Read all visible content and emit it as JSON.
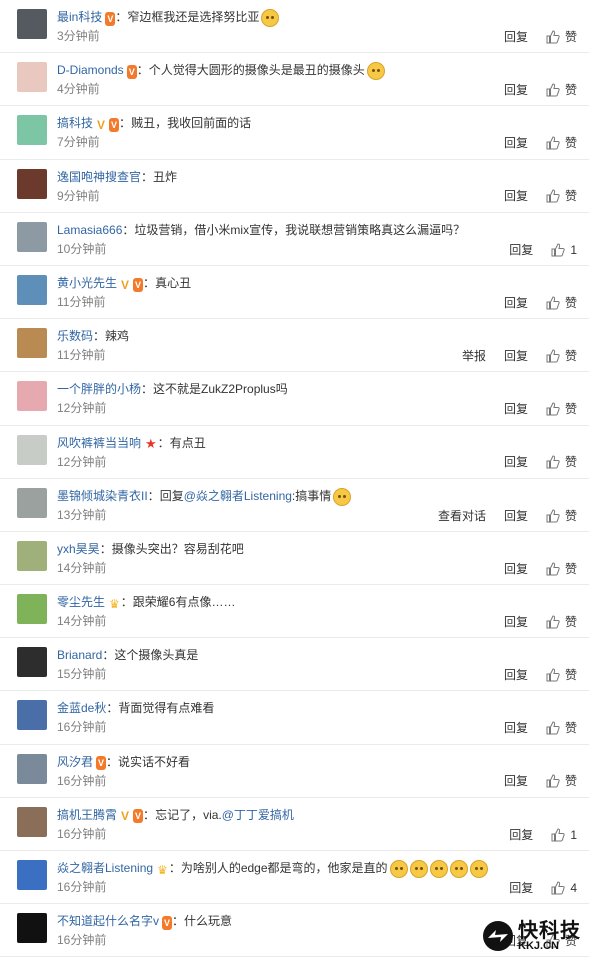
{
  "actions": {
    "reply": "回复",
    "report": "举报",
    "view_conversation": "查看对话",
    "like": "赞"
  },
  "colors": {
    "username": "#3266a3",
    "time": "#808080",
    "text": "#333333"
  },
  "watermark": {
    "cn": "快科技",
    "en": "KKJ.CN"
  },
  "comments": [
    {
      "avatar": {
        "color": "#555a60",
        "icon": "bird-avatar"
      },
      "user": "最in科技",
      "badges": [
        "vip"
      ],
      "text": "窄边框我还是选择努比亚",
      "emojis": 1,
      "time": "3分钟前",
      "report": false,
      "conversation": false,
      "likes": ""
    },
    {
      "avatar": {
        "color": "#e9c8c0",
        "icon": "girl-avatar"
      },
      "user": "D-Diamonds",
      "badges": [
        "vip"
      ],
      "text": "个人觉得大圆形的摄像头是最丑的摄像头",
      "emojis": 1,
      "time": "4分钟前",
      "report": false,
      "conversation": false,
      "likes": ""
    },
    {
      "avatar": {
        "color": "#7cc6a5",
        "icon": "default-avatar"
      },
      "user": "搞科技",
      "badges": [
        "v",
        "vip"
      ],
      "text": "贼丑，我收回前面的话",
      "emojis": 0,
      "time": "7分钟前",
      "report": false,
      "conversation": false,
      "likes": ""
    },
    {
      "avatar": {
        "color": "#6b3a2c",
        "icon": "photo-avatar"
      },
      "user": "逸国咆神搜查官",
      "badges": [],
      "text": "丑炸",
      "emojis": 0,
      "time": "9分钟前",
      "report": false,
      "conversation": false,
      "likes": ""
    },
    {
      "avatar": {
        "color": "#8d9aa3",
        "icon": "photo-avatar"
      },
      "user": "Lamasia666",
      "badges": [],
      "text": "垃圾营销，借小米mix宣传，我说联想营销策略真这么漏逼吗？",
      "emojis": 0,
      "time": "10分钟前",
      "report": false,
      "conversation": false,
      "likes": "1"
    },
    {
      "avatar": {
        "color": "#5d8fb8",
        "icon": "photo-avatar"
      },
      "user": "黄小光先生",
      "badges": [
        "v",
        "vip"
      ],
      "text": "真心丑",
      "emojis": 0,
      "time": "11分钟前",
      "report": false,
      "conversation": false,
      "likes": ""
    },
    {
      "avatar": {
        "color": "#b98a52",
        "icon": "bear-avatar"
      },
      "user": "乐数码",
      "badges": [],
      "text": "辣鸡",
      "emojis": 0,
      "time": "11分钟前",
      "report": true,
      "conversation": false,
      "likes": ""
    },
    {
      "avatar": {
        "color": "#e7a9b0",
        "icon": "photo-avatar"
      },
      "user": "一个胖胖的小杨",
      "badges": [],
      "text": "这不就是ZukZ2Proplus吗",
      "emojis": 0,
      "time": "12分钟前",
      "report": false,
      "conversation": false,
      "likes": ""
    },
    {
      "avatar": {
        "color": "#c8ccc6",
        "icon": "photo-avatar"
      },
      "user": "风吹裤裤当当响",
      "badges": [
        "star"
      ],
      "text": "有点丑",
      "emojis": 0,
      "time": "12分钟前",
      "report": false,
      "conversation": false,
      "likes": ""
    },
    {
      "avatar": {
        "color": "#9ba19e",
        "icon": "photo-avatar"
      },
      "user": "墨锦倾城染青衣II",
      "badges": [],
      "text_prefix": "回复",
      "mention": "@焱之翱者Listening",
      "text": ":搞事情",
      "emojis": 1,
      "time": "13分钟前",
      "report": false,
      "conversation": true,
      "likes": ""
    },
    {
      "avatar": {
        "color": "#a0b07a",
        "icon": "photo-avatar"
      },
      "user": "yxh昊昊",
      "badges": [],
      "text": "摄像头突出？容易刮花吧",
      "emojis": 0,
      "time": "14分钟前",
      "report": false,
      "conversation": false,
      "likes": ""
    },
    {
      "avatar": {
        "color": "#7fb35a",
        "icon": "monkey-avatar"
      },
      "user": "零尘先生",
      "badges": [
        "cup"
      ],
      "text": "跟荣耀6有点像……",
      "emojis": 0,
      "time": "14分钟前",
      "report": false,
      "conversation": false,
      "likes": ""
    },
    {
      "avatar": {
        "color": "#2d2d2d",
        "icon": "photo-avatar"
      },
      "user": "Brianard",
      "badges": [],
      "text": "这个摄像头真是",
      "emojis": 0,
      "time": "15分钟前",
      "report": false,
      "conversation": false,
      "likes": ""
    },
    {
      "avatar": {
        "color": "#4a6fa8",
        "icon": "photo-avatar"
      },
      "user": "金蓝de秋",
      "badges": [],
      "text": "背面觉得有点难看",
      "emojis": 0,
      "time": "16分钟前",
      "report": false,
      "conversation": false,
      "likes": ""
    },
    {
      "avatar": {
        "color": "#7a8a9a",
        "icon": "photo-avatar"
      },
      "user": "风汐君",
      "badges": [
        "vip"
      ],
      "text": "说实话不好看",
      "emojis": 0,
      "time": "16分钟前",
      "report": false,
      "conversation": false,
      "likes": ""
    },
    {
      "avatar": {
        "color": "#8a6e58",
        "icon": "photo-avatar"
      },
      "user": "搞机王腾霄",
      "badges": [
        "v",
        "vip"
      ],
      "text_prefix": "忘记了，via.",
      "mention": "@丁丁爱搞机",
      "text": "",
      "emojis": 0,
      "time": "16分钟前",
      "report": false,
      "conversation": false,
      "likes": "1"
    },
    {
      "avatar": {
        "color": "#3b6fc2",
        "icon": "cartoon-avatar"
      },
      "user": "焱之翱者Listening",
      "badges": [
        "cup"
      ],
      "text": "为啥别人的edge都是弯的，他家是直的",
      "emojis": 5,
      "time": "16分钟前",
      "report": false,
      "conversation": false,
      "likes": "4"
    },
    {
      "avatar": {
        "color": "#111111",
        "icon": "arrow-avatar"
      },
      "user": "不知道起什么名字v",
      "badges": [
        "vip"
      ],
      "text": "什么玩意",
      "emojis": 0,
      "time": "16分钟前",
      "report": false,
      "conversation": false,
      "likes": ""
    }
  ]
}
